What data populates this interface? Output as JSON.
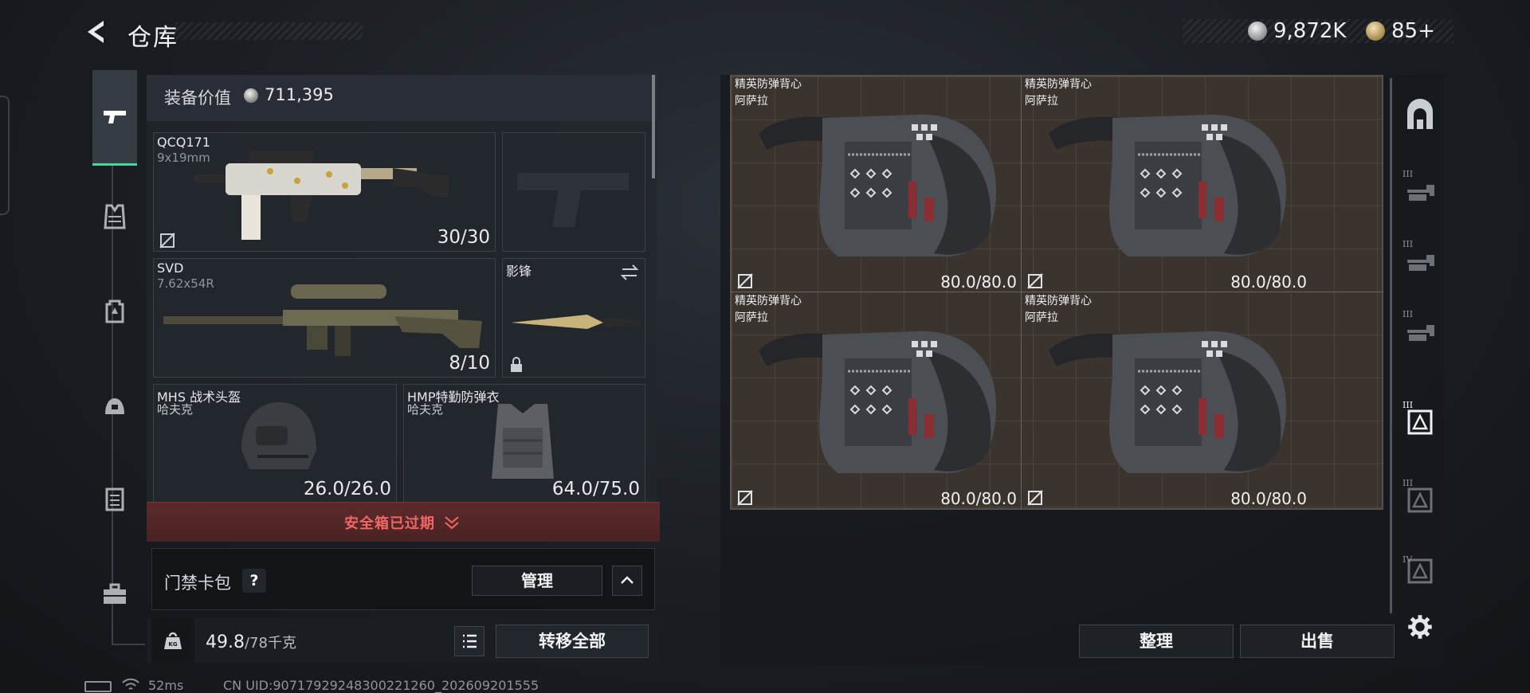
{
  "header": {
    "title": "仓库",
    "currency_silver": "9,872K",
    "currency_gold": "85+"
  },
  "sidebar": {
    "categories": [
      {
        "icon": "pistol-icon",
        "active": true
      },
      {
        "icon": "vest-icon"
      },
      {
        "icon": "backpack-icon"
      },
      {
        "icon": "helmet-icon"
      },
      {
        "icon": "medkit-icon"
      },
      {
        "icon": "toolbox-icon"
      }
    ]
  },
  "loadout": {
    "value_label": "装备价值",
    "value": "711,395",
    "primary": {
      "name": "QCQ171",
      "caliber": "9x19mm",
      "ammo": "30/30"
    },
    "sidearm": {
      "name": "",
      "empty": true
    },
    "secondary": {
      "name": "SVD",
      "caliber": "7.62x54R",
      "ammo": "8/10"
    },
    "melee": {
      "name": "影锋"
    },
    "helmet": {
      "name": "MHS 战术头盔",
      "brand": "哈夫克",
      "durability": "26.0/26.0"
    },
    "armor": {
      "name": "HMP特勤防弹衣",
      "brand": "哈夫克",
      "durability": "64.0/75.0"
    }
  },
  "safebox": {
    "expired_text": "安全箱已过期"
  },
  "keycard": {
    "label": "门禁卡包",
    "help": "?",
    "manage_label": "管理"
  },
  "capacity": {
    "current": "49.8",
    "max": "/78千克",
    "transfer_all_label": "转移全部"
  },
  "status": {
    "ping": "52ms",
    "uid": "CN UID:90717929248300221260_202609201555"
  },
  "storage": {
    "items": [
      {
        "name": "精英防弹背心",
        "brand": "阿萨拉",
        "durability": "80.0/80.0"
      },
      {
        "name": "精英防弹背心",
        "brand": "阿萨拉",
        "durability": "80.0/80.0"
      },
      {
        "name": "精英防弹背心",
        "brand": "阿萨拉",
        "durability": "80.0/80.0"
      },
      {
        "name": "精英防弹背心",
        "brand": "阿萨拉",
        "durability": "80.0/80.0"
      }
    ],
    "sort_label": "整理",
    "sell_label": "出售"
  },
  "filters": [
    {
      "icon": "all-items-icon",
      "tier": ""
    },
    {
      "icon": "vest-tier-icon",
      "tier": "III"
    },
    {
      "icon": "vest-tier-icon",
      "tier": "III"
    },
    {
      "icon": "vest-tier-icon",
      "tier": "III"
    },
    {
      "icon": "armor-tier-icon",
      "tier": "III",
      "active": true
    },
    {
      "icon": "armor-tier-icon",
      "tier": "III"
    },
    {
      "icon": "armor-tier-icon",
      "tier": "IV"
    }
  ],
  "colors": {
    "accent": "#43d79a",
    "danger": "#f06764",
    "grid_bg": "#3b332d"
  }
}
